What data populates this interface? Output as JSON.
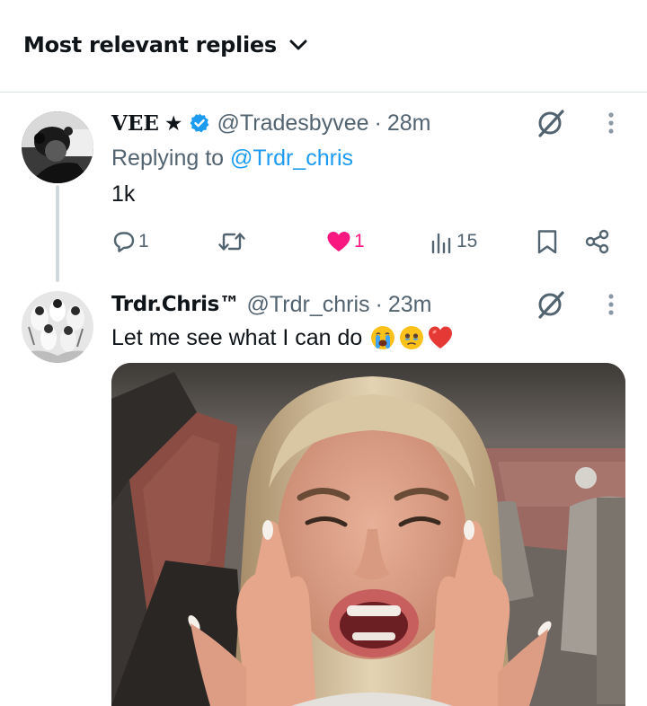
{
  "replies_header": {
    "label": "Most relevant replies"
  },
  "tweets": [
    {
      "display_name": "VEE",
      "star": "★",
      "handle": "@Tradesbyvee",
      "separator": "·",
      "time": "28m",
      "replying_prefix": "Replying to",
      "replying_to": "@Trdr_chris",
      "text": "1k",
      "stats": {
        "replies": "1",
        "likes": "1",
        "views": "15"
      }
    },
    {
      "display_name": "Trdr.Chris™",
      "handle": "@Trdr_chris",
      "separator": "·",
      "time": "23m",
      "text": "Let me see what I can do",
      "emojis": [
        "loudly-crying-face",
        "face-holding-back-tears",
        "red-heart"
      ]
    }
  ],
  "colors": {
    "text": "#0f1419",
    "muted": "#536471",
    "link": "#1d9bf0",
    "like": "#f91880",
    "divider": "#dfe6ea"
  }
}
